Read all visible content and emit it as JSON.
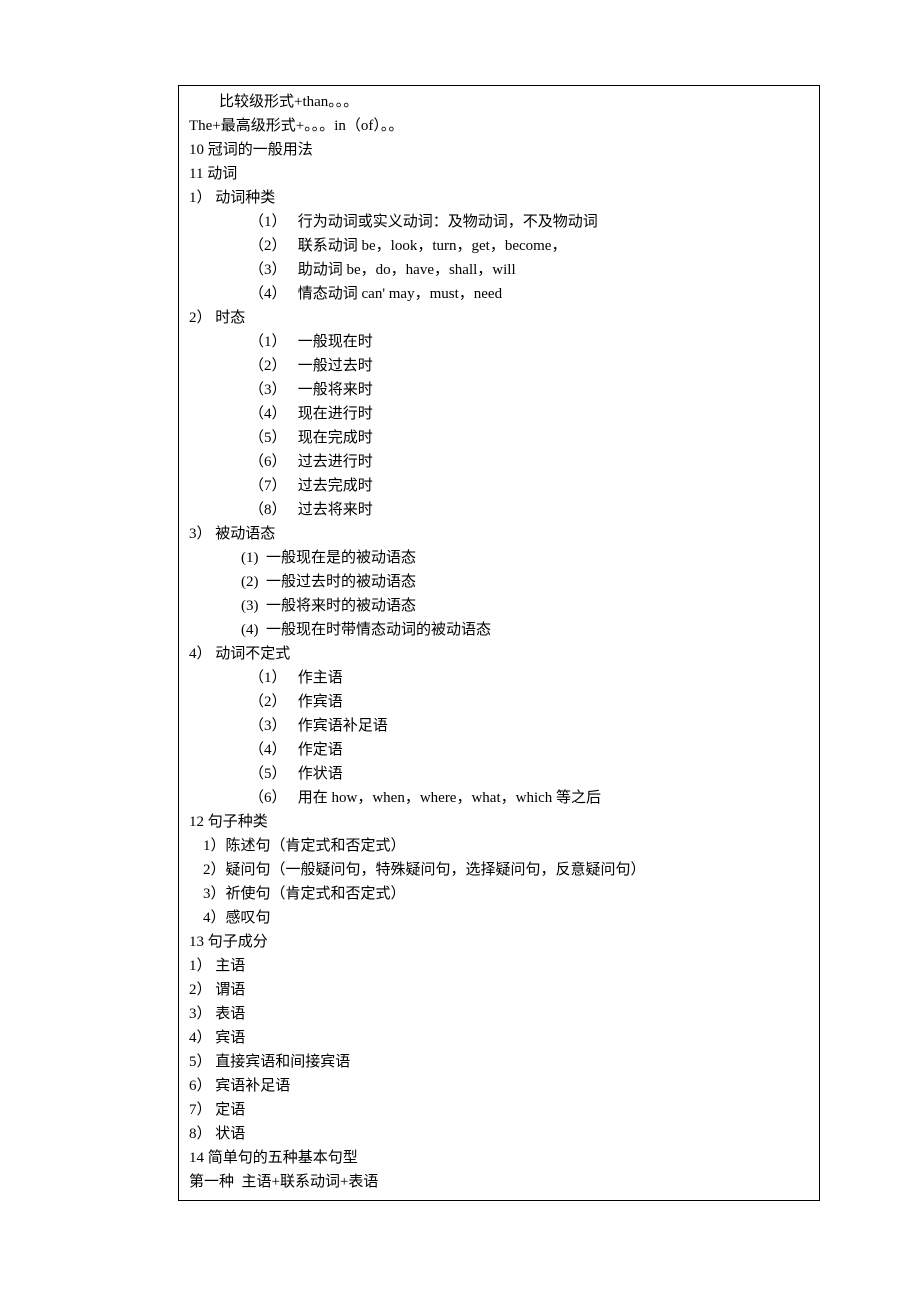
{
  "lines": [
    {
      "indent": "indent1",
      "text": "比较级形式+than。。。"
    },
    {
      "indent": "indent0",
      "text": "The+最高级形式+。。。in（of）。。"
    },
    {
      "indent": "indent0",
      "text": "10 冠词的一般用法"
    },
    {
      "indent": "indent0",
      "text": "11 动词"
    },
    {
      "indent": "indent0",
      "text": "1） 动词种类"
    },
    {
      "indent": "indent2",
      "text": "（1）   行为动词或实义动词：及物动词，不及物动词"
    },
    {
      "indent": "indent2",
      "text": "（2）   联系动词 be，look，turn，get，become，"
    },
    {
      "indent": "indent2",
      "text": "（3）   助动词 be，do，have，shall，will"
    },
    {
      "indent": "indent2",
      "text": "（4）   情态动词 can' may，must，need"
    },
    {
      "indent": "indent0",
      "text": "2） 时态"
    },
    {
      "indent": "indent2",
      "text": "（1）   一般现在时"
    },
    {
      "indent": "indent2",
      "text": "（2）   一般过去时"
    },
    {
      "indent": "indent2",
      "text": "（3）   一般将来时"
    },
    {
      "indent": "indent2",
      "text": "（4）   现在进行时"
    },
    {
      "indent": "indent2",
      "text": "（5）   现在完成时"
    },
    {
      "indent": "indent2",
      "text": "（6）   过去进行时"
    },
    {
      "indent": "indent2",
      "text": "（7）   过去完成时"
    },
    {
      "indent": "indent2",
      "text": "（8）   过去将来时"
    },
    {
      "indent": "indent0",
      "text": "3） 被动语态"
    },
    {
      "indent": "indent2b",
      "text": "(1)  一般现在是的被动语态"
    },
    {
      "indent": "indent2b",
      "text": "(2)  一般过去时的被动语态"
    },
    {
      "indent": "indent2b",
      "text": "(3)  一般将来时的被动语态"
    },
    {
      "indent": "indent2b",
      "text": "(4)  一般现在时带情态动词的被动语态"
    },
    {
      "indent": "indent0",
      "text": "4） 动词不定式"
    },
    {
      "indent": "indent2",
      "text": "（1）   作主语"
    },
    {
      "indent": "indent2",
      "text": "（2）   作宾语"
    },
    {
      "indent": "indent2",
      "text": "（3）   作宾语补足语"
    },
    {
      "indent": "indent2",
      "text": "（4）   作定语"
    },
    {
      "indent": "indent2",
      "text": "（5）   作状语"
    },
    {
      "indent": "indent2",
      "text": "（6）   用在 how，when，where，what，which 等之后"
    },
    {
      "indent": "indent0",
      "text": "12 句子种类"
    },
    {
      "indent": "indent1b",
      "text": "1）陈述句（肯定式和否定式）"
    },
    {
      "indent": "indent1b",
      "text": "2）疑问句（一般疑问句，特殊疑问句，选择疑问句，反意疑问句）"
    },
    {
      "indent": "indent1b",
      "text": "3）祈使句（肯定式和否定式）"
    },
    {
      "indent": "indent1b",
      "text": "4）感叹句"
    },
    {
      "indent": "indent0",
      "text": "13 句子成分"
    },
    {
      "indent": "indent0",
      "text": "1） 主语"
    },
    {
      "indent": "indent0",
      "text": "2） 谓语"
    },
    {
      "indent": "indent0",
      "text": "3） 表语"
    },
    {
      "indent": "indent0",
      "text": "4） 宾语"
    },
    {
      "indent": "indent0",
      "text": "5） 直接宾语和间接宾语"
    },
    {
      "indent": "indent0",
      "text": "6） 宾语补足语"
    },
    {
      "indent": "indent0",
      "text": "7） 定语"
    },
    {
      "indent": "indent0",
      "text": "8） 状语"
    },
    {
      "indent": "indent0",
      "text": "14 简单句的五种基本句型"
    },
    {
      "indent": "indent0",
      "text": "第一种  主语+联系动词+表语"
    }
  ]
}
